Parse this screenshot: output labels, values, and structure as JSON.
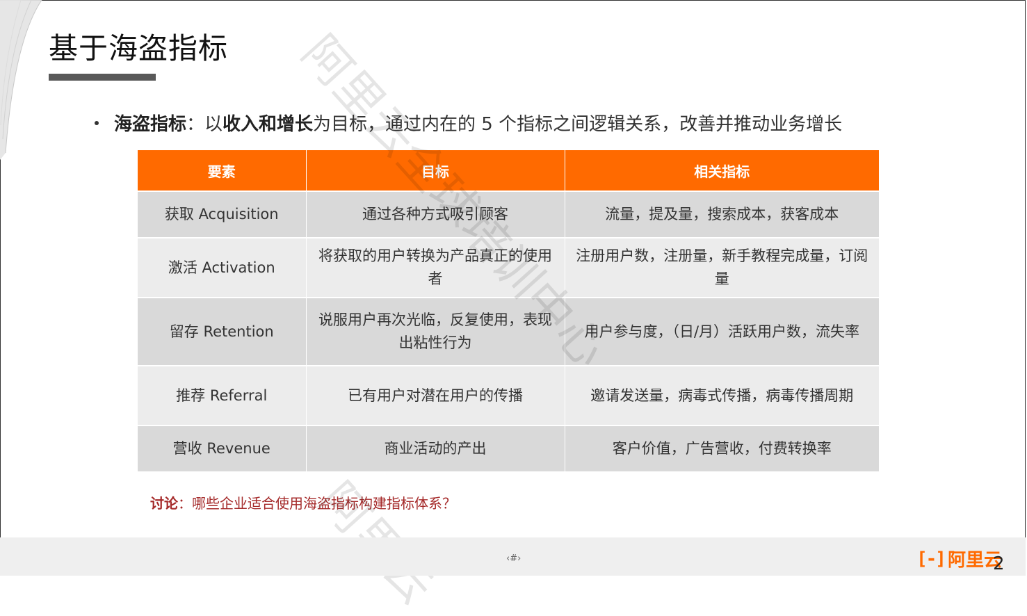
{
  "title": "基于海盗指标",
  "bullet": {
    "term": "海盗指标",
    "sep": "：以",
    "focus": "收入和增长",
    "rest": "为目标，通过内在的 5 个指标之间逻辑关系，改善并推动业务增长"
  },
  "table": {
    "headers": [
      "要素",
      "目标",
      "相关指标"
    ],
    "rows": [
      {
        "element": "获取 Acquisition",
        "goal": "通过各种方式吸引顾客",
        "metrics": "流量，提及量，搜索成本，获客成本"
      },
      {
        "element": "激活 Activation",
        "goal": "将获取的用户转换为产品真正的使用者",
        "metrics": "注册用户数，注册量，新手教程完成量，订阅量"
      },
      {
        "element": "留存 Retention",
        "goal": "说服用户再次光临，反复使用，表现出粘性行为",
        "metrics": "用户参与度，（日/月）活跃用户数，流失率"
      },
      {
        "element": "推荐 Referral",
        "goal": "已有用户对潜在用户的传播",
        "metrics": "邀请发送量，病毒式传播，病毒传播周期"
      },
      {
        "element": "营收 Revenue",
        "goal": "商业活动的产出",
        "metrics": "客户价值，广告营收，付费转换率"
      }
    ]
  },
  "discussion": {
    "label": "讨论",
    "sep": "：",
    "question": "哪些企业适合使用海盗指标构建指标体系？"
  },
  "watermark": {
    "text1": "阿里云全球培训中心",
    "text2": "阿里云"
  },
  "footer": {
    "page_marker": "‹#›",
    "logo_mark": "[-]",
    "logo_text": "阿里云",
    "page_number": "2"
  },
  "colors": {
    "accent": "#ff6a00",
    "discussion": "#a52a2a",
    "row_dark": "#d9d9d9",
    "row_light": "#ececec"
  }
}
